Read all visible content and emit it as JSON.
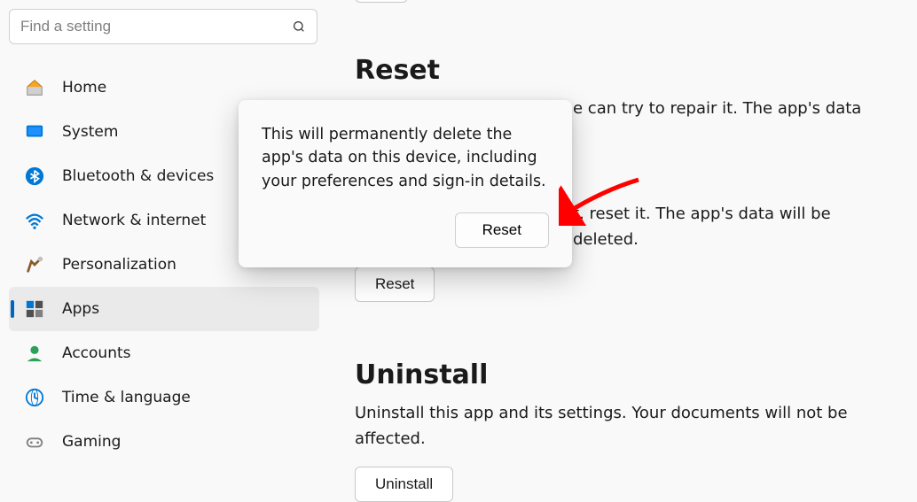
{
  "search": {
    "placeholder": "Find a setting"
  },
  "nav": {
    "items": [
      {
        "label": "Home"
      },
      {
        "label": "System"
      },
      {
        "label": "Bluetooth & devices"
      },
      {
        "label": "Network & internet"
      },
      {
        "label": "Personalization"
      },
      {
        "label": "Apps"
      },
      {
        "label": "Accounts"
      },
      {
        "label": "Time & language"
      },
      {
        "label": "Gaming"
      }
    ]
  },
  "main": {
    "repair_desc_tail": "e can try to repair it. The app's data",
    "reset": {
      "title": "Reset",
      "desc_tail": "t, reset it. The app's data will be deleted.",
      "button": "Reset"
    },
    "uninstall": {
      "title": "Uninstall",
      "desc": "Uninstall this app and its settings. Your documents will not be affected.",
      "button": "Uninstall"
    }
  },
  "popup": {
    "text": "This will permanently delete the app's data on this device, including your preferences and sign-in details.",
    "button": "Reset"
  }
}
